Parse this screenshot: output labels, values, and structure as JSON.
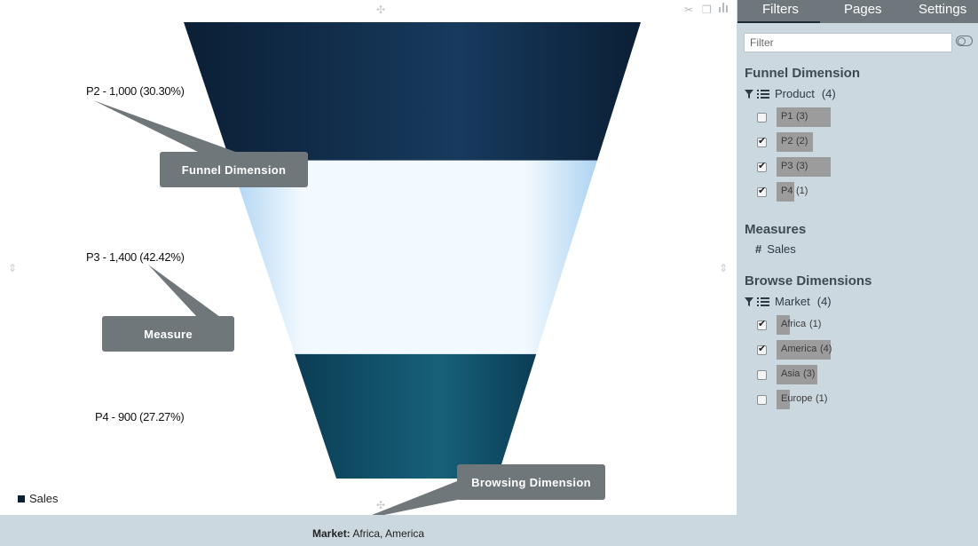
{
  "chart": {
    "segments": [
      {
        "label": "P2 - 1,000 (30.30%)",
        "value": 1000,
        "percent": 30.3,
        "colors": [
          "#0b1f35",
          "#173a5e",
          "#0b1f35"
        ]
      },
      {
        "label": "P3 - 1,400 (42.42%)",
        "value": 1400,
        "percent": 42.42,
        "colors": [
          "#aed3f2",
          "#f3faff",
          "#aed3f2"
        ]
      },
      {
        "label": "P4 - 900 (27.27%)",
        "value": 900,
        "percent": 27.27,
        "colors": [
          "#0b3d55",
          "#166179",
          "#0b3d55"
        ]
      }
    ],
    "callouts": {
      "funnel_dimension": "Funnel Dimension",
      "measure": "Measure",
      "browsing_dimension": "Browsing Dimension"
    },
    "legend": "Sales",
    "footer_key": "Market:",
    "footer_value": "Africa, America"
  },
  "chart_data": {
    "type": "funnel",
    "categories": [
      "P2",
      "P3",
      "P4"
    ],
    "values": [
      1000,
      1400,
      900
    ],
    "percents": [
      30.3,
      42.42,
      27.27
    ],
    "series": [
      {
        "name": "Sales",
        "values": [
          1000,
          1400,
          900
        ]
      }
    ],
    "legend_position": "bottom-left"
  },
  "tabs": [
    "Filters",
    "Pages",
    "Settings"
  ],
  "filter": {
    "placeholder": "Filter"
  },
  "funnel_dimension": {
    "title": "Funnel Dimension",
    "field": "Product",
    "count": "(4)",
    "items": [
      {
        "name": "P1",
        "count": "(3)",
        "checked": false,
        "fill": 1.0
      },
      {
        "name": "P2",
        "count": "(2)",
        "checked": true,
        "fill": 0.667
      },
      {
        "name": "P3",
        "count": "(3)",
        "checked": true,
        "fill": 1.0
      },
      {
        "name": "P4",
        "count": "(1)",
        "checked": true,
        "fill": 0.333
      }
    ]
  },
  "measures": {
    "title": "Measures",
    "icon": "#",
    "items": [
      "Sales"
    ]
  },
  "browse_dimensions": {
    "title": "Browse Dimensions",
    "field": "Market",
    "count": "(4)",
    "items": [
      {
        "name": "Africa",
        "count": "(1)",
        "checked": true,
        "fill": 0.25
      },
      {
        "name": "America",
        "count": "(4)",
        "checked": true,
        "fill": 1.0
      },
      {
        "name": "Asia",
        "count": "(3)",
        "checked": false,
        "fill": 0.75
      },
      {
        "name": "Europe",
        "count": "(1)",
        "checked": false,
        "fill": 0.25
      }
    ]
  }
}
